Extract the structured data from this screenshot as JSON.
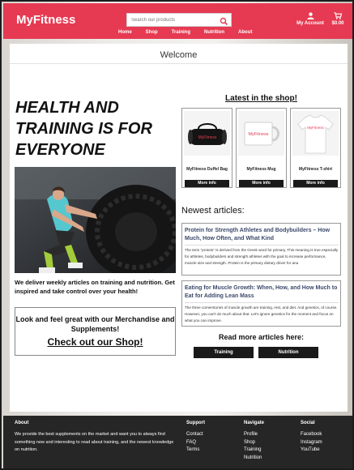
{
  "header": {
    "logo": "MyFitness",
    "search_placeholder": "Search our products",
    "nav": [
      "Home",
      "Shop",
      "Training",
      "Nutrition",
      "About"
    ],
    "account_label": "My Account",
    "cart_label": "$0.00",
    "accent_color": "#e63a52"
  },
  "main": {
    "welcome": "Welcome",
    "hero_title": "HEALTH AND TRAINING IS FOR EVERYONE",
    "tagline": "We deliver weekly articles on training and nutrition. Get inspired and take control over your health!",
    "promo_text": "Look and feel great with our Merchandise and Supplements!",
    "promo_link": "Check out our Shop!",
    "shop_heading": "Latest in the shop!",
    "products": [
      {
        "name": "MyFitness Duffel Bag",
        "button": "More info",
        "image_label": "MyFitness"
      },
      {
        "name": "MyFitness Mug",
        "button": "More info",
        "image_label": "MyFitness"
      },
      {
        "name": "MyFitness T-shirt",
        "button": "More info",
        "image_label": "MyFitness"
      }
    ],
    "articles_heading": "Newest articles:",
    "articles": [
      {
        "title": "Protein for Strength Athletes and Bodybuilders – How Much, How Often, and What Kind",
        "body": "The term \"protein\" is derived from the Greek word for primary. This meaning is true especially for athletes, bodybuilders and strength athletes with the goal to increase performance, muscle size and strength. Protein is the primary dietary driver for ana"
      },
      {
        "title": "Eating for Muscle Growth: When, How, and How Much to Eat for Adding Lean Mass",
        "body": "The three cornerstones of muscle growth are training, rest, and diet. And genetics, of course. However, you can't do much about that. Let's ignore genetics for the moment and focus on what you can improve."
      }
    ],
    "read_more_heading": "Read more articles here:",
    "read_more_buttons": [
      "Training",
      "Nutrition"
    ]
  },
  "footer": {
    "about_heading": "About",
    "about_text": "We provide the best supplements on the market and want you to always find something new and interesting to read about training, and the newest knowledge on nutrition.",
    "support_heading": "Support",
    "support_links": [
      "Contact",
      "FAQ",
      "Terms"
    ],
    "navigate_heading": "Navigate",
    "navigate_links": [
      "Profile",
      "Shop",
      "Training",
      "Nutrition"
    ],
    "social_heading": "Social",
    "social_links": [
      "Facebook",
      "Instagram",
      "YouTube"
    ]
  }
}
